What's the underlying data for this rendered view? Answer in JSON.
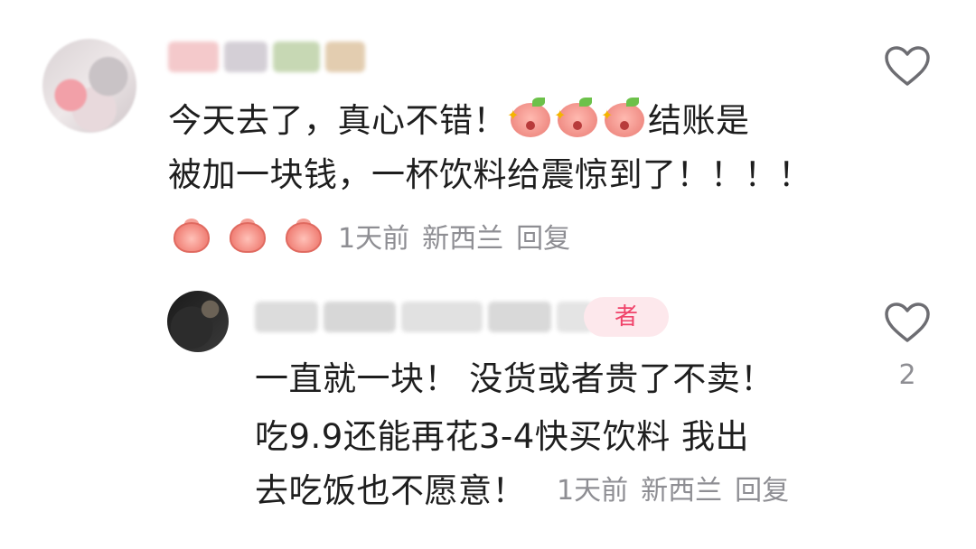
{
  "comment": {
    "text_line1": "今天去了，真心不错！",
    "text_after_emoji": "结账是",
    "text_line2": "被加一块钱，一杯饮料给震惊到了！！！！",
    "time": "1天前",
    "location": "新西兰",
    "reply_label": "回复",
    "emoji_reactions": [
      "surprised-face",
      "surprised-face",
      "surprised-face"
    ],
    "trailing_emojis": [
      "peach",
      "peach",
      "peach"
    ]
  },
  "reply": {
    "badge_label": "者",
    "text_line1": "一直就一块！ 没货或者贵了不卖！",
    "text_line2": "吃9.9还能再花3-4快买饮料 我出",
    "text_line3": "去吃饭也不愿意！",
    "time": "1天前",
    "location": "新西兰",
    "reply_label": "回复",
    "like_count": "2"
  },
  "colors": {
    "text": "#1e1e1e",
    "meta": "#8e8e93",
    "badge_text": "#f0436a",
    "badge_bg": "#fde8ec"
  }
}
